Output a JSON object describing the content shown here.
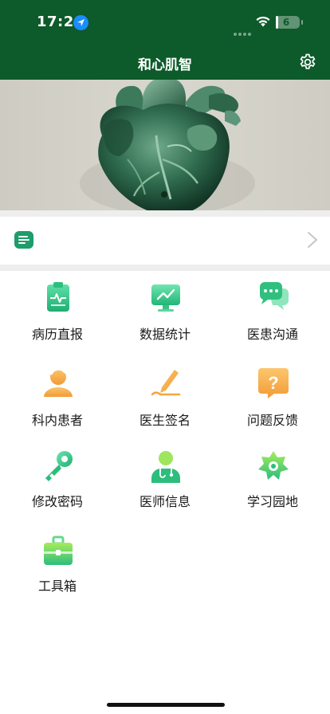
{
  "status_bar": {
    "time": "17:20",
    "battery": "6",
    "battery_level": 0.06,
    "icons": [
      "location-arrow-icon",
      "signal-dots-icon",
      "wifi-icon",
      "battery-charging-icon"
    ]
  },
  "nav": {
    "title": "和心肌智",
    "settings_icon": "gear-icon"
  },
  "banner": {
    "subject": "heart-illustration"
  },
  "notice": {
    "icon": "notice-list-icon",
    "text": "",
    "chevron": "chevron-right-icon"
  },
  "menu": [
    {
      "label": "病历直报",
      "icon": "medical-record-icon"
    },
    {
      "label": "数据统计",
      "icon": "monitor-chart-icon"
    },
    {
      "label": "医患沟通",
      "icon": "chat-bubbles-icon"
    },
    {
      "label": "科内患者",
      "icon": "patient-icon"
    },
    {
      "label": "医生签名",
      "icon": "signature-pen-icon"
    },
    {
      "label": "问题反馈",
      "icon": "question-icon"
    },
    {
      "label": "修改密码",
      "icon": "key-icon"
    },
    {
      "label": "医师信息",
      "icon": "doctor-icon"
    },
    {
      "label": "学习园地",
      "icon": "flower-icon"
    },
    {
      "label": "工具箱",
      "icon": "toolbox-icon"
    }
  ],
  "colors": {
    "header_green": "#0d5a2a",
    "accent_green": "#3ecf8e",
    "orange": "#f6a13a"
  }
}
